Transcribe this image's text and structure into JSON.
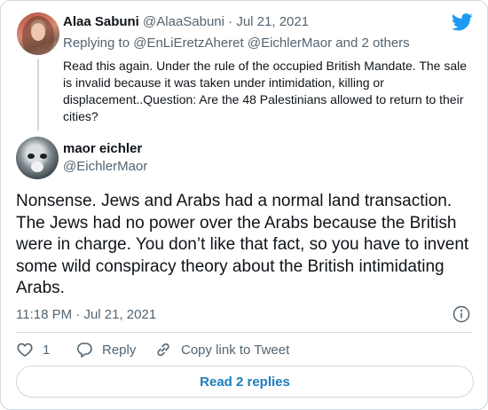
{
  "parent_tweet": {
    "author_name": "Alaa Sabuni",
    "author_handle": "@AlaaSabuni",
    "separator": "·",
    "date": "Jul 21, 2021",
    "replying_prefix": "Replying to",
    "replying_to": "@EnLiEretzAheret @EichlerMaor and 2 others",
    "text": "Read this again.  Under the rule of the occupied British Mandate. The sale is invalid because it was taken under intimidation, killing or displacement..Question: Are the 48 Palestinians allowed to return to their cities?"
  },
  "main_tweet": {
    "author_name": "maor eichler",
    "author_handle": "@EichlerMaor",
    "text": "Nonsense. Jews and Arabs had a normal land transaction. The Jews had no power over the Arabs because the British were in charge. You don’t like that fact, so you have to invent some wild conspiracy theory about the British intimidating Arabs.",
    "time": "11:18 PM",
    "separator": "·",
    "date": "Jul 21, 2021"
  },
  "actions": {
    "like_count": "1",
    "reply_label": "Reply",
    "copy_label": "Copy link to Tweet"
  },
  "read_replies_label": "Read 2 replies",
  "icons": {
    "brand": "twitter-bird-icon",
    "info": "info-icon",
    "like": "heart-icon",
    "reply": "speech-bubble-icon",
    "copy": "link-icon"
  },
  "colors": {
    "twitter_blue": "#1d9bf0",
    "link_blue": "#1d7dbd",
    "secondary_text": "#536471",
    "border": "#cfd9de"
  }
}
